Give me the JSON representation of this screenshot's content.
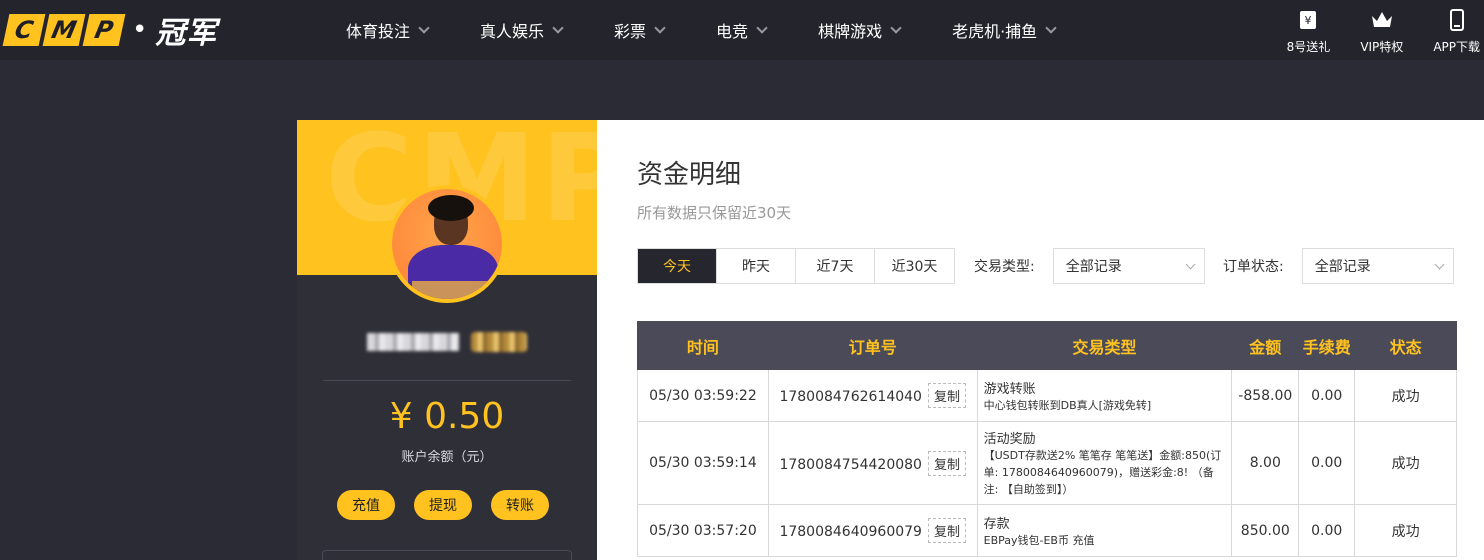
{
  "header": {
    "logo_letters": [
      "C",
      "M",
      "P"
    ],
    "logo_cn": "冠军",
    "nav": [
      {
        "label": "体育投注"
      },
      {
        "label": "真人娱乐"
      },
      {
        "label": "彩票"
      },
      {
        "label": "电竞"
      },
      {
        "label": "棋牌游戏"
      },
      {
        "label": "老虎机·捕鱼"
      }
    ],
    "right": [
      {
        "label": "8号送礼",
        "icon": "gift-ticket-icon"
      },
      {
        "label": "VIP特权",
        "icon": "crown-icon"
      },
      {
        "label": "APP下载",
        "icon": "phone-icon"
      }
    ]
  },
  "profile": {
    "bg_text": "CMP",
    "balance": "¥ 0.50",
    "balance_label": "账户余额（元）",
    "actions": [
      {
        "label": "充值"
      },
      {
        "label": "提现"
      },
      {
        "label": "转账"
      }
    ]
  },
  "panel": {
    "title": "资金明细",
    "subtitle": "所有数据只保留近30天",
    "tabs": [
      {
        "label": "今天",
        "active": true
      },
      {
        "label": "昨天",
        "active": false
      },
      {
        "label": "近7天",
        "active": false
      },
      {
        "label": "近30天",
        "active": false
      }
    ],
    "filters": {
      "type_label": "交易类型:",
      "type_value": "全部记录",
      "status_label": "订单状态:",
      "status_value": "全部记录"
    },
    "table": {
      "headers": [
        "时间",
        "订单号",
        "交易类型",
        "金额",
        "手续费",
        "状态"
      ],
      "copy_label": "复制",
      "rows": [
        {
          "time": "05/30 03:59:22",
          "order": "1780084762614040",
          "type_title": "游戏转账",
          "type_desc": "中心钱包转账到DB真人[游戏免转]",
          "amount": "-858.00",
          "fee": "0.00",
          "status": "成功"
        },
        {
          "time": "05/30 03:59:14",
          "order": "1780084754420080",
          "type_title": "活动奖励",
          "type_desc": "【USDT存款送2% 笔笔存 笔笔送】金额:850(订单: 1780084640960079)，赠送彩金:8! （备注: 【自助签到】）",
          "amount": "8.00",
          "fee": "0.00",
          "status": "成功"
        },
        {
          "time": "05/30 03:57:20",
          "order": "1780084640960079",
          "type_title": "存款",
          "type_desc": "EBPay钱包-EB币 充值",
          "amount": "850.00",
          "fee": "0.00",
          "status": "成功"
        }
      ]
    }
  },
  "colors": {
    "accent": "#ffc21f",
    "header_bg": "#24242c",
    "page_bg": "#2b2b35",
    "table_head_bg": "#4a4a58",
    "success": "#1aa51a"
  }
}
